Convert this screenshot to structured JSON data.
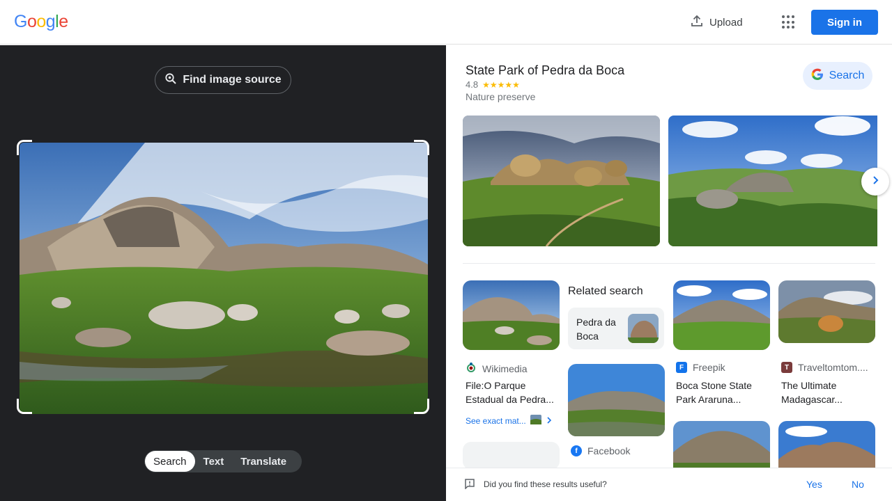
{
  "header": {
    "logo_letters": [
      {
        "ch": "G",
        "color": "#4285F4"
      },
      {
        "ch": "o",
        "color": "#EA4335"
      },
      {
        "ch": "o",
        "color": "#FBBC05"
      },
      {
        "ch": "g",
        "color": "#4285F4"
      },
      {
        "ch": "l",
        "color": "#34A853"
      },
      {
        "ch": "e",
        "color": "#EA4335"
      }
    ],
    "upload_label": "Upload",
    "upload_icon": "upload-icon",
    "apps_icon": "apps-grid-icon",
    "signin_label": "Sign in"
  },
  "left_panel": {
    "find_source_label": "Find image source",
    "tabs": [
      {
        "label": "Search",
        "active": true
      },
      {
        "label": "Text",
        "active": false
      },
      {
        "label": "Translate",
        "active": false
      }
    ]
  },
  "knowledge_panel": {
    "title": "State Park of Pedra da Boca",
    "rating": "4.8",
    "stars": "★★★★★",
    "type": "Nature preserve",
    "search_button": "Search"
  },
  "results": [
    {
      "source": "Wikimedia",
      "title": "File:O Parque Estadual da Pedra...",
      "exact_match": "See exact mat..."
    },
    {
      "source": "Facebook",
      "title": ""
    },
    {
      "source": "Freepik",
      "title": "Boca Stone State Park Araruna..."
    },
    {
      "source": "Traveltomtom....",
      "title": "The Ultimate Madagascar..."
    }
  ],
  "related": {
    "heading": "Related search",
    "chip_label": "Pedra da Boca"
  },
  "feedback": {
    "question": "Did you find these results useful?",
    "yes": "Yes",
    "no": "No"
  },
  "colors": {
    "accent": "#1a73e8",
    "dark_panel": "#202124",
    "star": "#fbbc04"
  }
}
